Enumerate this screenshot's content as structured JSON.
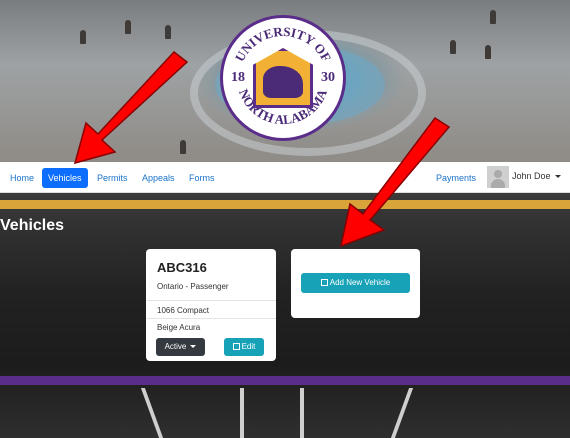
{
  "seal": {
    "top_text": "UNIVERSITY OF",
    "bottom_text": "NORTH ALABAMA",
    "year_left": "18",
    "year_right": "30"
  },
  "nav": {
    "items": [
      {
        "label": "Home",
        "active": false
      },
      {
        "label": "Vehicles",
        "active": true
      },
      {
        "label": "Permits",
        "active": false
      },
      {
        "label": "Appeals",
        "active": false
      },
      {
        "label": "Forms",
        "active": false
      }
    ],
    "payments": "Payments",
    "user": "John Doe"
  },
  "page_title": "Vehicles",
  "vehicle": {
    "plate": "ABC316",
    "registration": "Ontario - Passenger",
    "model": "1066 Compact",
    "color_make": "Beige Acura",
    "status_label": "Active",
    "edit_label": "Edit"
  },
  "add_vehicle_label": "Add New Vehicle",
  "colors": {
    "accent_blue": "#0d6efd",
    "teal": "#17a2b8",
    "gold": "#d9a53a",
    "purple": "#5b2d8a",
    "arrow_red": "#ff0000"
  }
}
